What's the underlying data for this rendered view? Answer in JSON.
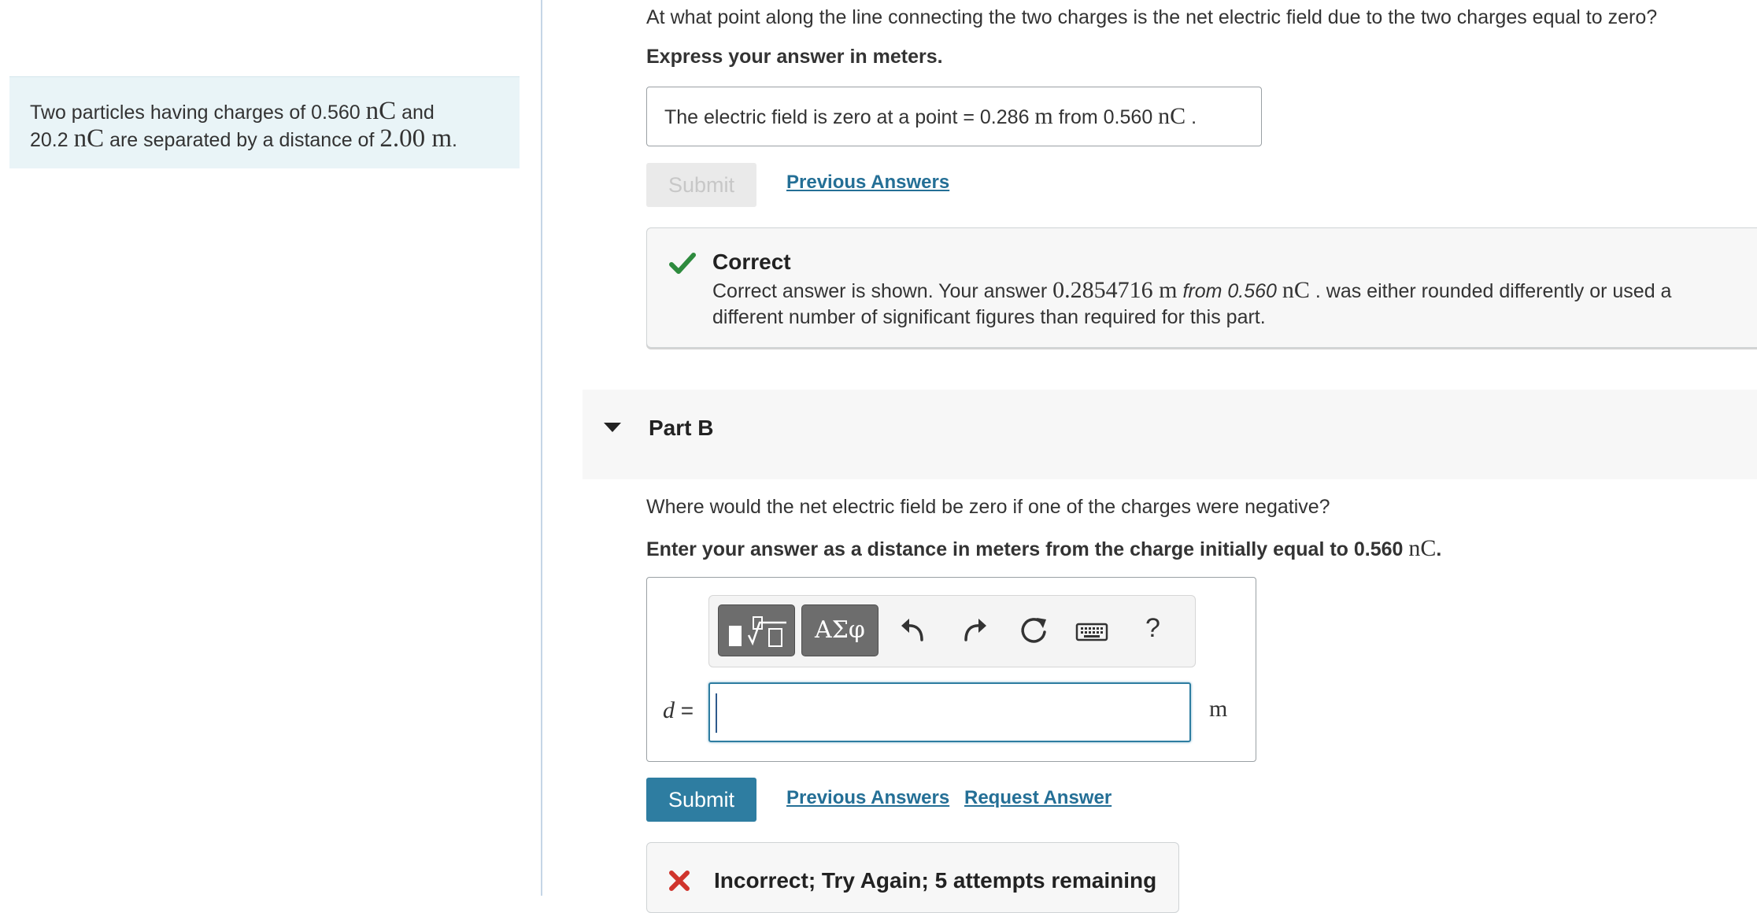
{
  "problem": {
    "parts": [
      "Two particles having charges of 0.560 ",
      "nC",
      " and",
      "20.2 ",
      "nC",
      " are separated by a distance of ",
      "2.00 m",
      "."
    ]
  },
  "part_a": {
    "question": "At what point along the line connecting the two charges is the net electric field due to the two charges equal to zero?",
    "instruction": "Express your answer in meters.",
    "answer_prefix": "The electric field is zero at a point = ",
    "answer_value": "0.286",
    "answer_unit": "m",
    "answer_from": " from 0.560 ",
    "answer_charge_unit": "nC",
    "answer_end": " .",
    "submit_label": "Submit",
    "previous_answers_label": "Previous Answers",
    "feedback": {
      "title": "Correct",
      "msg_1": "Correct answer is shown. Your answer ",
      "msg_value": "0.2854716 m",
      "msg_from": " from 0.560",
      "msg_unit": "nC",
      "msg_2": " . was either rounded differently or used a different number of significant figures than required for this part."
    }
  },
  "part_b": {
    "title": "Part B",
    "question": "Where would the net electric field be zero if one of the charges were negative?",
    "instruction": "Enter your answer as a distance in meters from the charge initially equal to 0.560 ",
    "instruction_unit": "nC",
    "instruction_end": ".",
    "symbols_label": "ΑΣφ",
    "help_label": "?",
    "var_label": "d",
    "equals": " =",
    "input_value": "",
    "unit": "m",
    "submit_label": "Submit",
    "previous_answers_label": "Previous Answers",
    "request_answer_label": "Request Answer",
    "feedback": {
      "title": "Incorrect; Try Again; 5 attempts remaining"
    }
  },
  "colors": {
    "accent": "#2e7da1",
    "correct": "#2e8b3e",
    "incorrect": "#d0342c"
  }
}
